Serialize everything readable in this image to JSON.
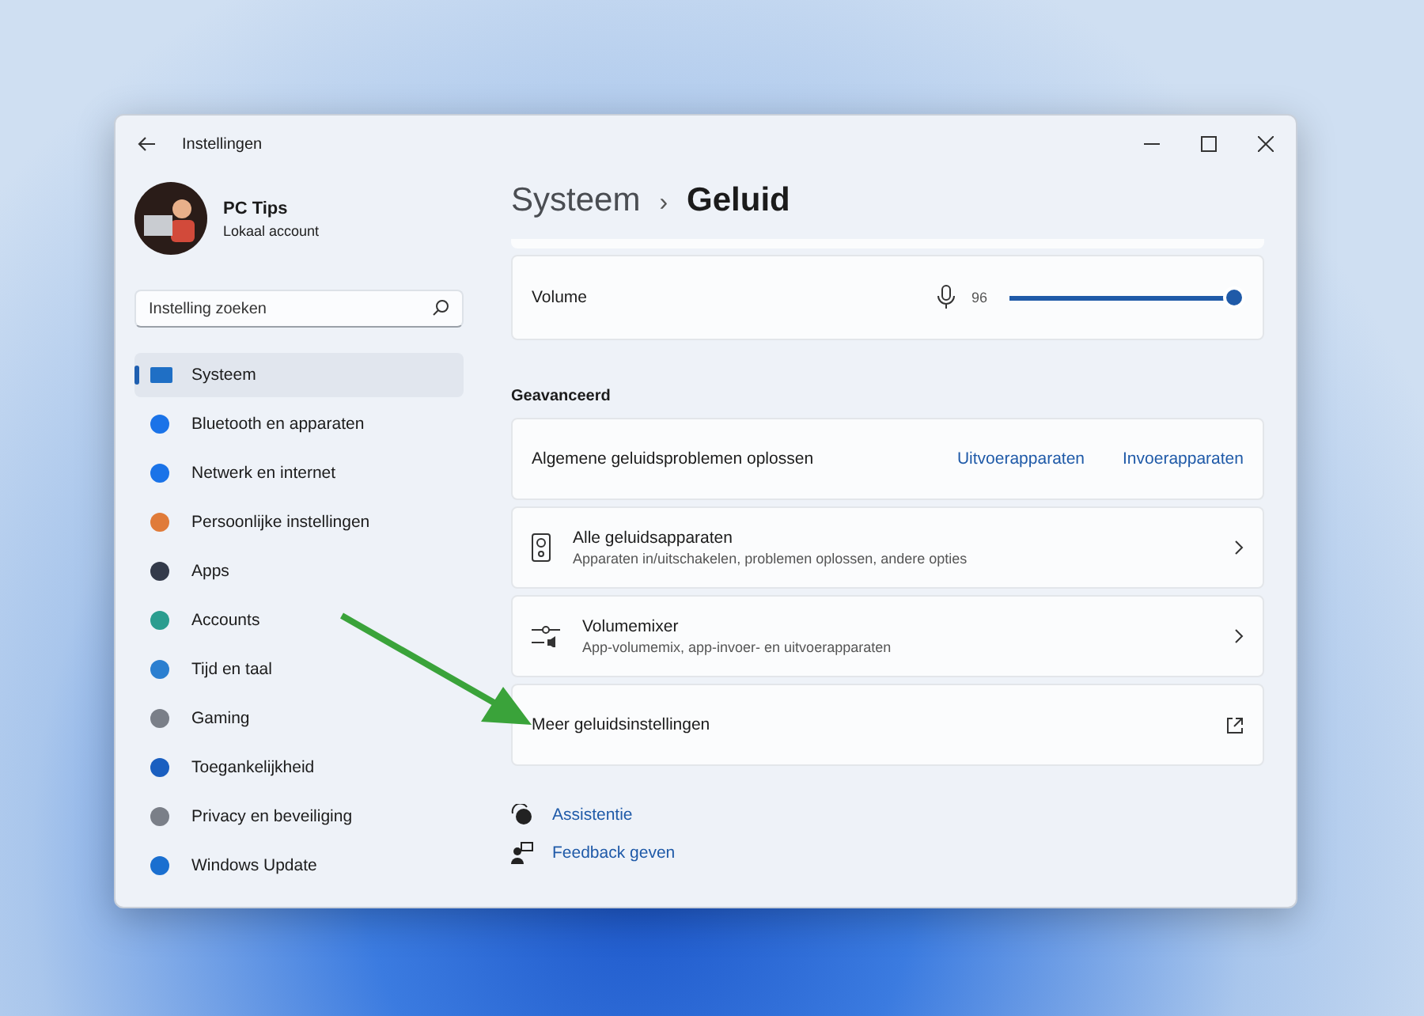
{
  "window": {
    "title": "Instellingen"
  },
  "profile": {
    "name": "PC Tips",
    "account": "Lokaal account"
  },
  "search": {
    "placeholder": "Instelling zoeken"
  },
  "sidebar": {
    "items": [
      {
        "label": "Systeem",
        "selected": true
      },
      {
        "label": "Bluetooth en apparaten",
        "selected": false
      },
      {
        "label": "Netwerk en internet",
        "selected": false
      },
      {
        "label": "Persoonlijke instellingen",
        "selected": false
      },
      {
        "label": "Apps",
        "selected": false
      },
      {
        "label": "Accounts",
        "selected": false
      },
      {
        "label": "Tijd en taal",
        "selected": false
      },
      {
        "label": "Gaming",
        "selected": false
      },
      {
        "label": "Toegankelijkheid",
        "selected": false
      },
      {
        "label": "Privacy en beveiliging",
        "selected": false
      },
      {
        "label": "Windows Update",
        "selected": false
      }
    ]
  },
  "breadcrumb": {
    "parent": "Systeem",
    "separator": "›",
    "current": "Geluid"
  },
  "volume": {
    "label": "Volume",
    "reading": "96",
    "level": 0.96
  },
  "section_title": "Geavanceerd",
  "troubleshoot": {
    "label": "Algemene geluidsproblemen oplossen",
    "links": [
      "Uitvoerapparaten",
      "Invoerapparaten"
    ]
  },
  "cards": [
    {
      "kind": "nav",
      "title": "Alle geluidsapparaten",
      "subtitle": "Apparaten in/uitschakelen, problemen oplossen, andere opties"
    },
    {
      "kind": "nav",
      "title": "Volumemixer",
      "subtitle": "App-volumemix, app-invoer- en uitvoerapparaten"
    },
    {
      "kind": "external",
      "title": "Meer geluidsinstellingen"
    }
  ],
  "footer_links": [
    "Assistentie",
    "Feedback geven"
  ]
}
